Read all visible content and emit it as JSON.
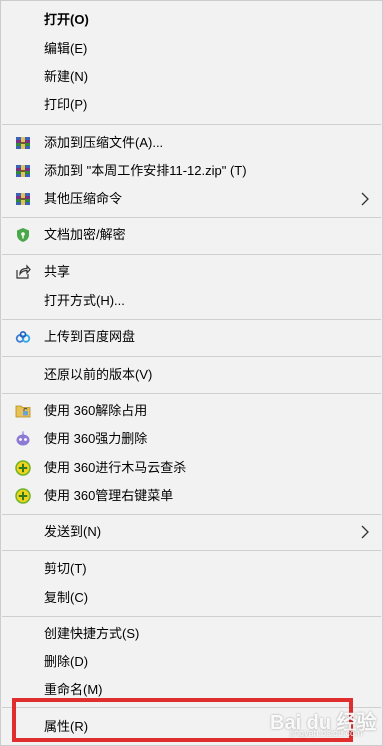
{
  "menu": {
    "open": "打开(O)",
    "edit": "编辑(E)",
    "new": "新建(N)",
    "print": "打印(P)",
    "add_to_archive": "添加到压缩文件(A)...",
    "add_to_zip": "添加到 \"本周工作安排11-12.zip\" (T)",
    "other_compress": "其他压缩命令",
    "encrypt": "文档加密/解密",
    "share": "共享",
    "open_with": "打开方式(H)...",
    "upload_baidu": "上传到百度网盘",
    "restore_previous": "还原以前的版本(V)",
    "unlock_360": "使用 360解除占用",
    "force_delete_360": "使用 360强力删除",
    "trojan_scan_360": "使用 360进行木马云查杀",
    "manage_menu_360": "使用 360管理右键菜单",
    "send_to": "发送到(N)",
    "cut": "剪切(T)",
    "copy": "复制(C)",
    "create_shortcut": "创建快捷方式(S)",
    "delete": "删除(D)",
    "rename": "重命名(M)",
    "properties": "属性(R)"
  },
  "icons": {
    "add_to_archive": "winrar-archive-icon",
    "add_to_zip": "winrar-archive-icon",
    "other_compress": "winrar-archive-icon",
    "encrypt": "shield-lock-icon",
    "share": "share-icon",
    "upload_baidu": "baidu-netdisk-icon",
    "unlock_360": "folder-unlock-icon",
    "force_delete_360": "purple-robot-icon",
    "trojan_scan_360": "360-plus-icon",
    "manage_menu_360": "360-plus-icon"
  },
  "colors": {
    "menu_bg": "#f2f2f2",
    "highlight_border": "#e02d2d",
    "separator": "#cfcfcf"
  },
  "watermark": {
    "text": "Bai du 经验",
    "sub": "jingyan.baidu.com"
  }
}
